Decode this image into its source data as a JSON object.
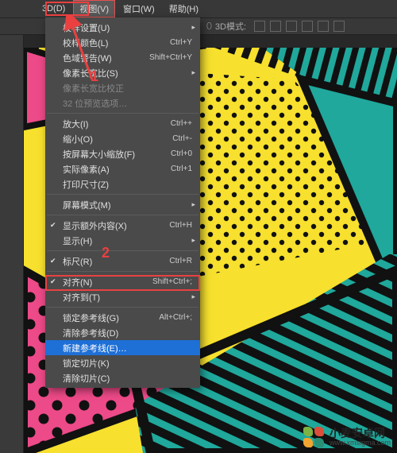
{
  "menubar": {
    "items": [
      {
        "label": "3D(D)"
      },
      {
        "label": "视图(V)",
        "active": true
      },
      {
        "label": "窗口(W)"
      },
      {
        "label": "帮助(H)"
      }
    ]
  },
  "topbar": {
    "mode_label": "3D模式:"
  },
  "dropdown": {
    "groups": [
      [
        {
          "label": "校样设置(U)",
          "submenu": true
        },
        {
          "label": "校样颜色(L)",
          "shortcut": "Ctrl+Y"
        },
        {
          "label": "色域警告(W)",
          "shortcut": "Shift+Ctrl+Y"
        },
        {
          "label": "像素长宽比(S)",
          "submenu": true
        },
        {
          "label": "像素长宽比校正",
          "disabled": true
        },
        {
          "label": "32 位预览选项…",
          "disabled": true
        }
      ],
      [
        {
          "label": "放大(I)",
          "shortcut": "Ctrl++"
        },
        {
          "label": "缩小(O)",
          "shortcut": "Ctrl+-"
        },
        {
          "label": "按屏幕大小缩放(F)",
          "shortcut": "Ctrl+0"
        },
        {
          "label": "实际像素(A)",
          "shortcut": "Ctrl+1"
        },
        {
          "label": "打印尺寸(Z)"
        }
      ],
      [
        {
          "label": "屏幕模式(M)",
          "submenu": true
        }
      ],
      [
        {
          "label": "显示额外内容(X)",
          "shortcut": "Ctrl+H",
          "checked": true
        },
        {
          "label": "显示(H)",
          "submenu": true
        }
      ],
      [
        {
          "label": "标尺(R)",
          "shortcut": "Ctrl+R",
          "checked": true
        }
      ],
      [
        {
          "label": "对齐(N)",
          "shortcut": "Shift+Ctrl+;",
          "checked": true
        },
        {
          "label": "对齐到(T)",
          "submenu": true
        }
      ],
      [
        {
          "label": "锁定参考线(G)",
          "shortcut": "Alt+Ctrl+;"
        },
        {
          "label": "清除参考线(D)"
        },
        {
          "label": "新建参考线(E)…",
          "highlight": true
        },
        {
          "label": "锁定切片(K)"
        },
        {
          "label": "清除切片(C)"
        }
      ]
    ]
  },
  "annotations": {
    "label_1": "1",
    "label_2": "2"
  },
  "watermark": {
    "title": "小麦安卓网",
    "url": "www.xmsigma.com",
    "leaf_colors": [
      "#7cb342",
      "#d94f3a",
      "#f2a531",
      "#2a8f74"
    ]
  },
  "art": {
    "yellow": "#f7e02e",
    "pink": "#ec4a88",
    "teal": "#1fa89b",
    "black": "#111111"
  }
}
